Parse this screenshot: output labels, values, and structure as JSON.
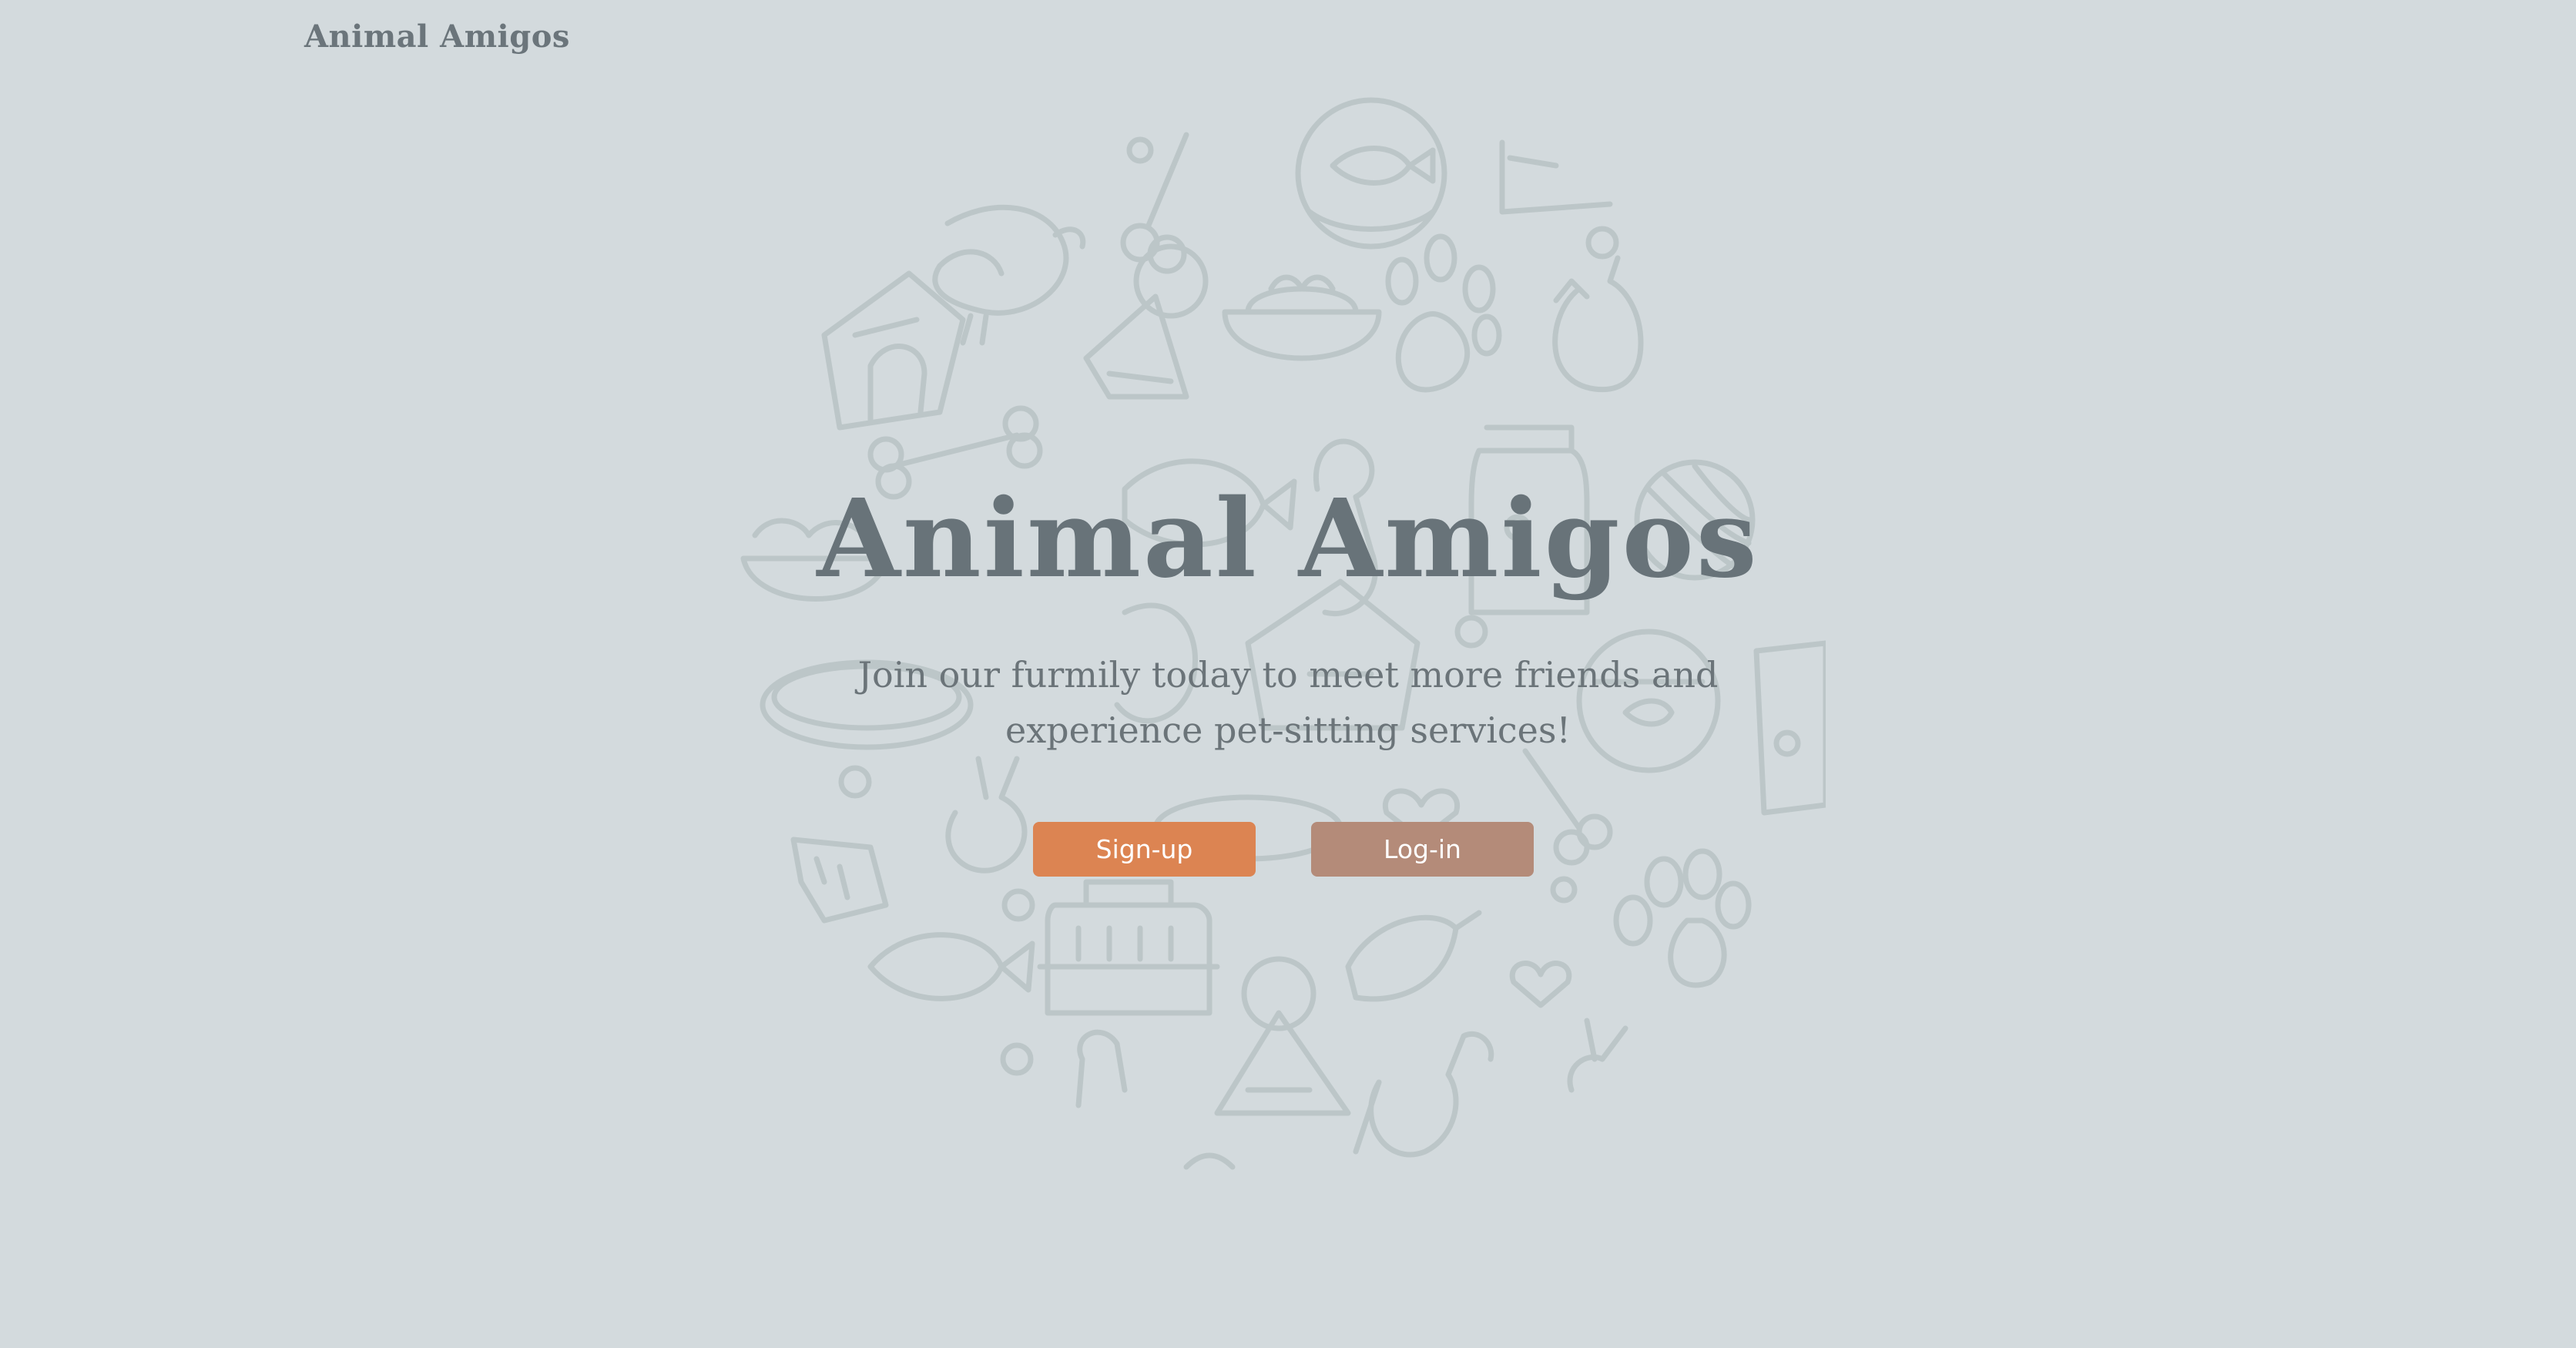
{
  "header": {
    "brand": "Animal Amigos"
  },
  "hero": {
    "title": "Animal Amigos",
    "subtitle": "Join our furmily today to meet more friends and experience pet-sitting services!",
    "buttons": {
      "signup_label": "Sign-up",
      "login_label": "Log-in"
    }
  },
  "colors": {
    "background": "#d3dadd",
    "text": "#687379",
    "pattern_stroke": "#bcc6c8",
    "signup_button": "#dc8452",
    "login_button": "#b48b79"
  },
  "pattern_icons": [
    "parrot-icon",
    "bone-icon",
    "fishbowl-icon",
    "dog-house-icon",
    "pet-tag-icon",
    "food-bowl-icon",
    "paw-print-icon",
    "cat-icon",
    "yarn-ball-icon",
    "food-bag-icon",
    "collar-icon",
    "pet-carrier-icon",
    "fish-icon",
    "rabbit-icon",
    "heart-icon",
    "dog-icon"
  ]
}
